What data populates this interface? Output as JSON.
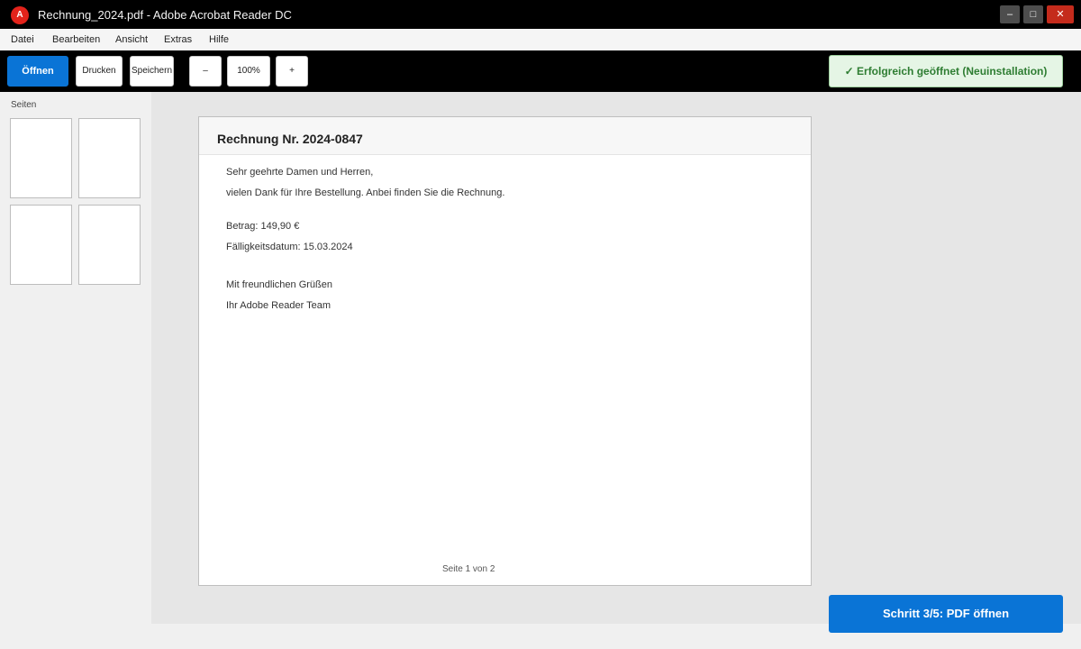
{
  "window": {
    "logo_letter": "A",
    "title": "Rechnung_2024.pdf - Adobe Acrobat Reader DC",
    "minimize": "–",
    "maximize": "□",
    "close": "✕"
  },
  "menu": {
    "items": [
      "Datei",
      "Bearbeiten",
      "Ansicht",
      "Extras",
      "Hilfe"
    ]
  },
  "toolbar": {
    "open_label": "Öffnen",
    "print_label": "Drucken",
    "save_label": "Speichern",
    "zoom_out_label": "–",
    "zoom_value": "100%",
    "zoom_in_label": "+",
    "status_text": "✓ Erfolgreich geöffnet (Neuinstallation)"
  },
  "sidebar": {
    "title": "Seiten"
  },
  "document": {
    "title": "Rechnung Nr. 2024-0847",
    "lines": [
      "Sehr geehrte Damen und Herren,",
      "vielen Dank für Ihre Bestellung. Anbei finden Sie die Rechnung.",
      "Betrag: 149,90 €",
      "Fälligkeitsdatum: 15.03.2024",
      "Mit freundlichen Grüßen",
      "Ihr Adobe Reader Team"
    ],
    "footer": "Seite 1 von 2"
  },
  "step_button": {
    "label": "Schritt 3/5: PDF öffnen"
  },
  "colors": {
    "accent": "#0a74d6",
    "brand_red": "#e3231b",
    "success_green": "#2e7d32",
    "close_red": "#c42b1c"
  },
  "icons": {
    "app_logo": "adobe-acrobat-icon",
    "status": "checkmark-icon"
  }
}
